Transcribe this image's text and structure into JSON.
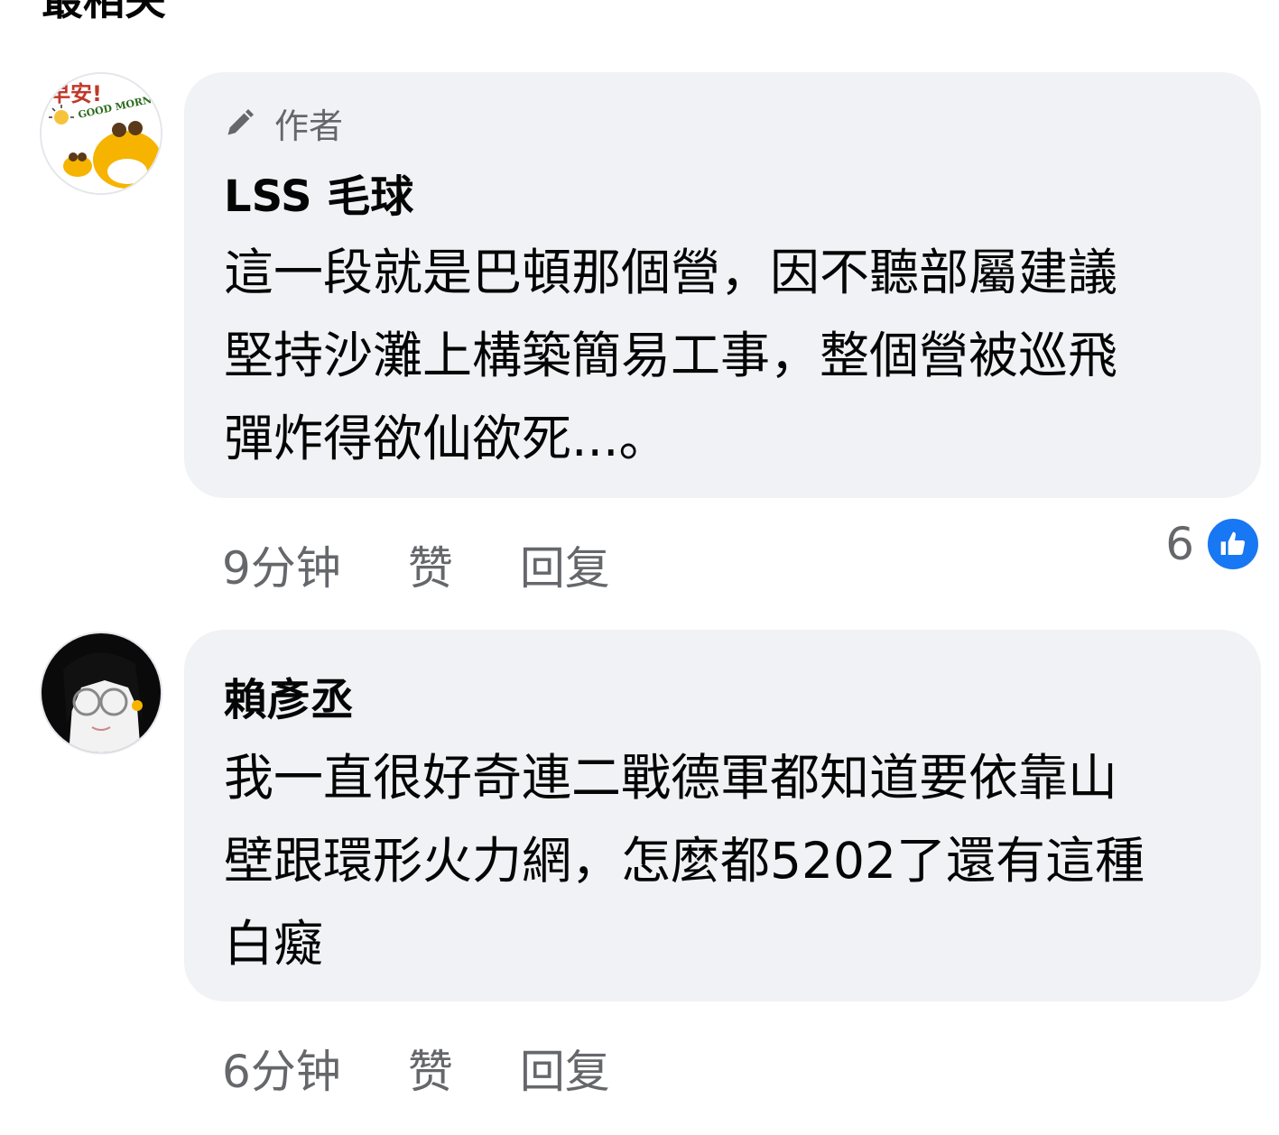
{
  "header": {
    "partial_title": "最相关"
  },
  "comments": [
    {
      "badge": "作者",
      "author": "LSS 毛球",
      "lines": [
        "這一段就是巴頓那個營，因不聽部屬建議",
        "堅持沙灘上構築簡易工事，整個營被巡飛",
        "彈炸得欲仙欲死...。"
      ],
      "time": "9分钟",
      "like_label": "赞",
      "reply_label": "回复",
      "reaction_count": "6",
      "avatar_text_1": "早安!",
      "avatar_text_2": "GOOD MORNIN"
    },
    {
      "author": "賴彥丞",
      "lines": [
        "我一直很好奇連二戰德軍都知道要依靠山",
        "壁跟環形火力網，怎麼都5202了還有這種",
        "白癡"
      ],
      "time": "6分钟",
      "like_label": "赞",
      "reply_label": "回复"
    }
  ],
  "colors": {
    "bubble": "#f0f2f5",
    "meta": "#65676b",
    "like_blue": "#1877f2"
  },
  "icons": {
    "author_badge": "pencil-icon",
    "reaction": "thumbs-up-icon"
  }
}
